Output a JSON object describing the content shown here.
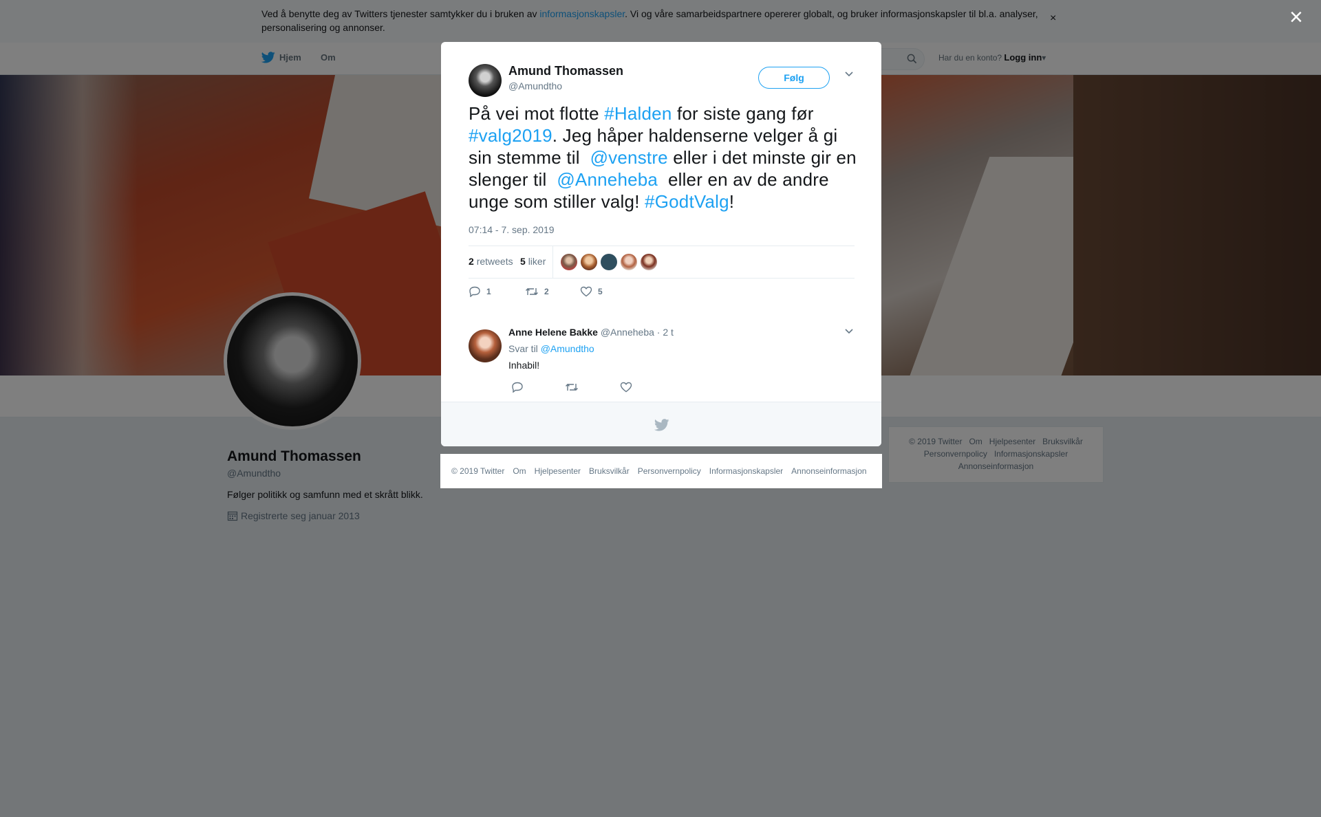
{
  "cookie": {
    "text_before": "Ved å benytte deg av Twitters tjenester samtykker du i bruken av ",
    "link": "informasjonskapsler",
    "text_after": ". Vi og våre samarbeidspartnere opererer globalt, og bruker informasjonskapsler til bl.a. analyser, personalisering og annonser.",
    "close": "×"
  },
  "nav": {
    "home": "Hjem",
    "about": "Om",
    "login_prompt": "Har du en konto?",
    "login": "Logg inn"
  },
  "profile": {
    "name": "Amund Thomassen",
    "handle": "@Amundtho",
    "bio": "Følger politikk og samfunn med et skrått blikk.",
    "joined": "Registrerte seg januar 2013"
  },
  "right_footer": [
    "© 2019 Twitter",
    "Om",
    "Hjelpesenter",
    "Bruksvilkår",
    "Personvernpolicy",
    "Informasjonskapsler",
    "Annonseinformasjon"
  ],
  "overlay_close": "×",
  "tweet": {
    "name": "Amund Thomassen",
    "handle": "@Amundtho",
    "follow": "Følg",
    "text": [
      {
        "t": "På vei mot flotte "
      },
      {
        "t": "#Halden",
        "link": true
      },
      {
        "t": " for siste gang før "
      },
      {
        "t": "#valg2019",
        "link": true
      },
      {
        "t": ". Jeg håper haldenserne velger å gi sin stemme til  "
      },
      {
        "t": "@venstre",
        "link": true
      },
      {
        "t": " eller i det minste gir en slenger til  "
      },
      {
        "t": "@Anneheba",
        "link": true
      },
      {
        "t": "  eller en av de andre unge som stiller valg! "
      },
      {
        "t": "#GodtValg",
        "link": true
      },
      {
        "t": "!"
      }
    ],
    "time": "07:14 - 7. sep. 2019",
    "retweets": "2",
    "retweets_label": "retweets",
    "likes": "5",
    "likes_label": "liker",
    "reply_count": "1",
    "retweet_count": "2",
    "like_count": "5"
  },
  "reply": {
    "name": "Anne Helene Bakke",
    "handle": "@Anneheba",
    "age": "· 2 t",
    "reply_to_label": "Svar til",
    "reply_to": "@Amundtho",
    "text": "Inhabil!"
  },
  "modal_footer": [
    "© 2019 Twitter",
    "Om",
    "Hjelpesenter",
    "Bruksvilkår",
    "Personvernpolicy",
    "Informasjonskapsler",
    "Annonseinformasjon"
  ],
  "colors": {
    "accent": "#1da1f2",
    "text": "#14171a",
    "muted": "#657786"
  }
}
